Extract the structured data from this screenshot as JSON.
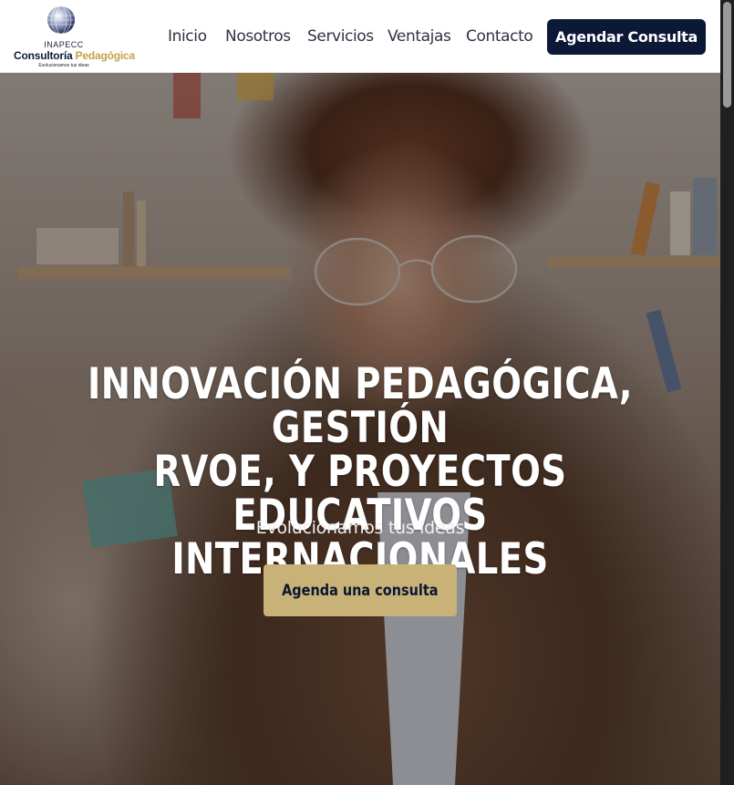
{
  "brand": {
    "top_text": "INAPECC",
    "name_part1": "Consultoría",
    "name_part2": "Pedagógica",
    "tagline": "Evolucionamos tus ideas"
  },
  "nav": {
    "items": [
      {
        "label": "Inicio"
      },
      {
        "label": "Nosotros"
      },
      {
        "label": "Servicios"
      },
      {
        "label": "Ventajas"
      },
      {
        "label": "Contacto"
      }
    ],
    "cta_label": "Agendar Consulta"
  },
  "hero": {
    "title_line1": "INNOVACIÓN PEDAGÓGICA, GESTIÓN",
    "title_line2": "RVOE, Y PROYECTOS EDUCATIVOS",
    "title_line3": "INTERNACIONALES",
    "subtitle": "Evolucionamos tus ideas",
    "cta_label": "Agenda una consulta"
  },
  "colors": {
    "navy": "#0b1836",
    "gold": "#c8b278",
    "white": "#ffffff"
  }
}
